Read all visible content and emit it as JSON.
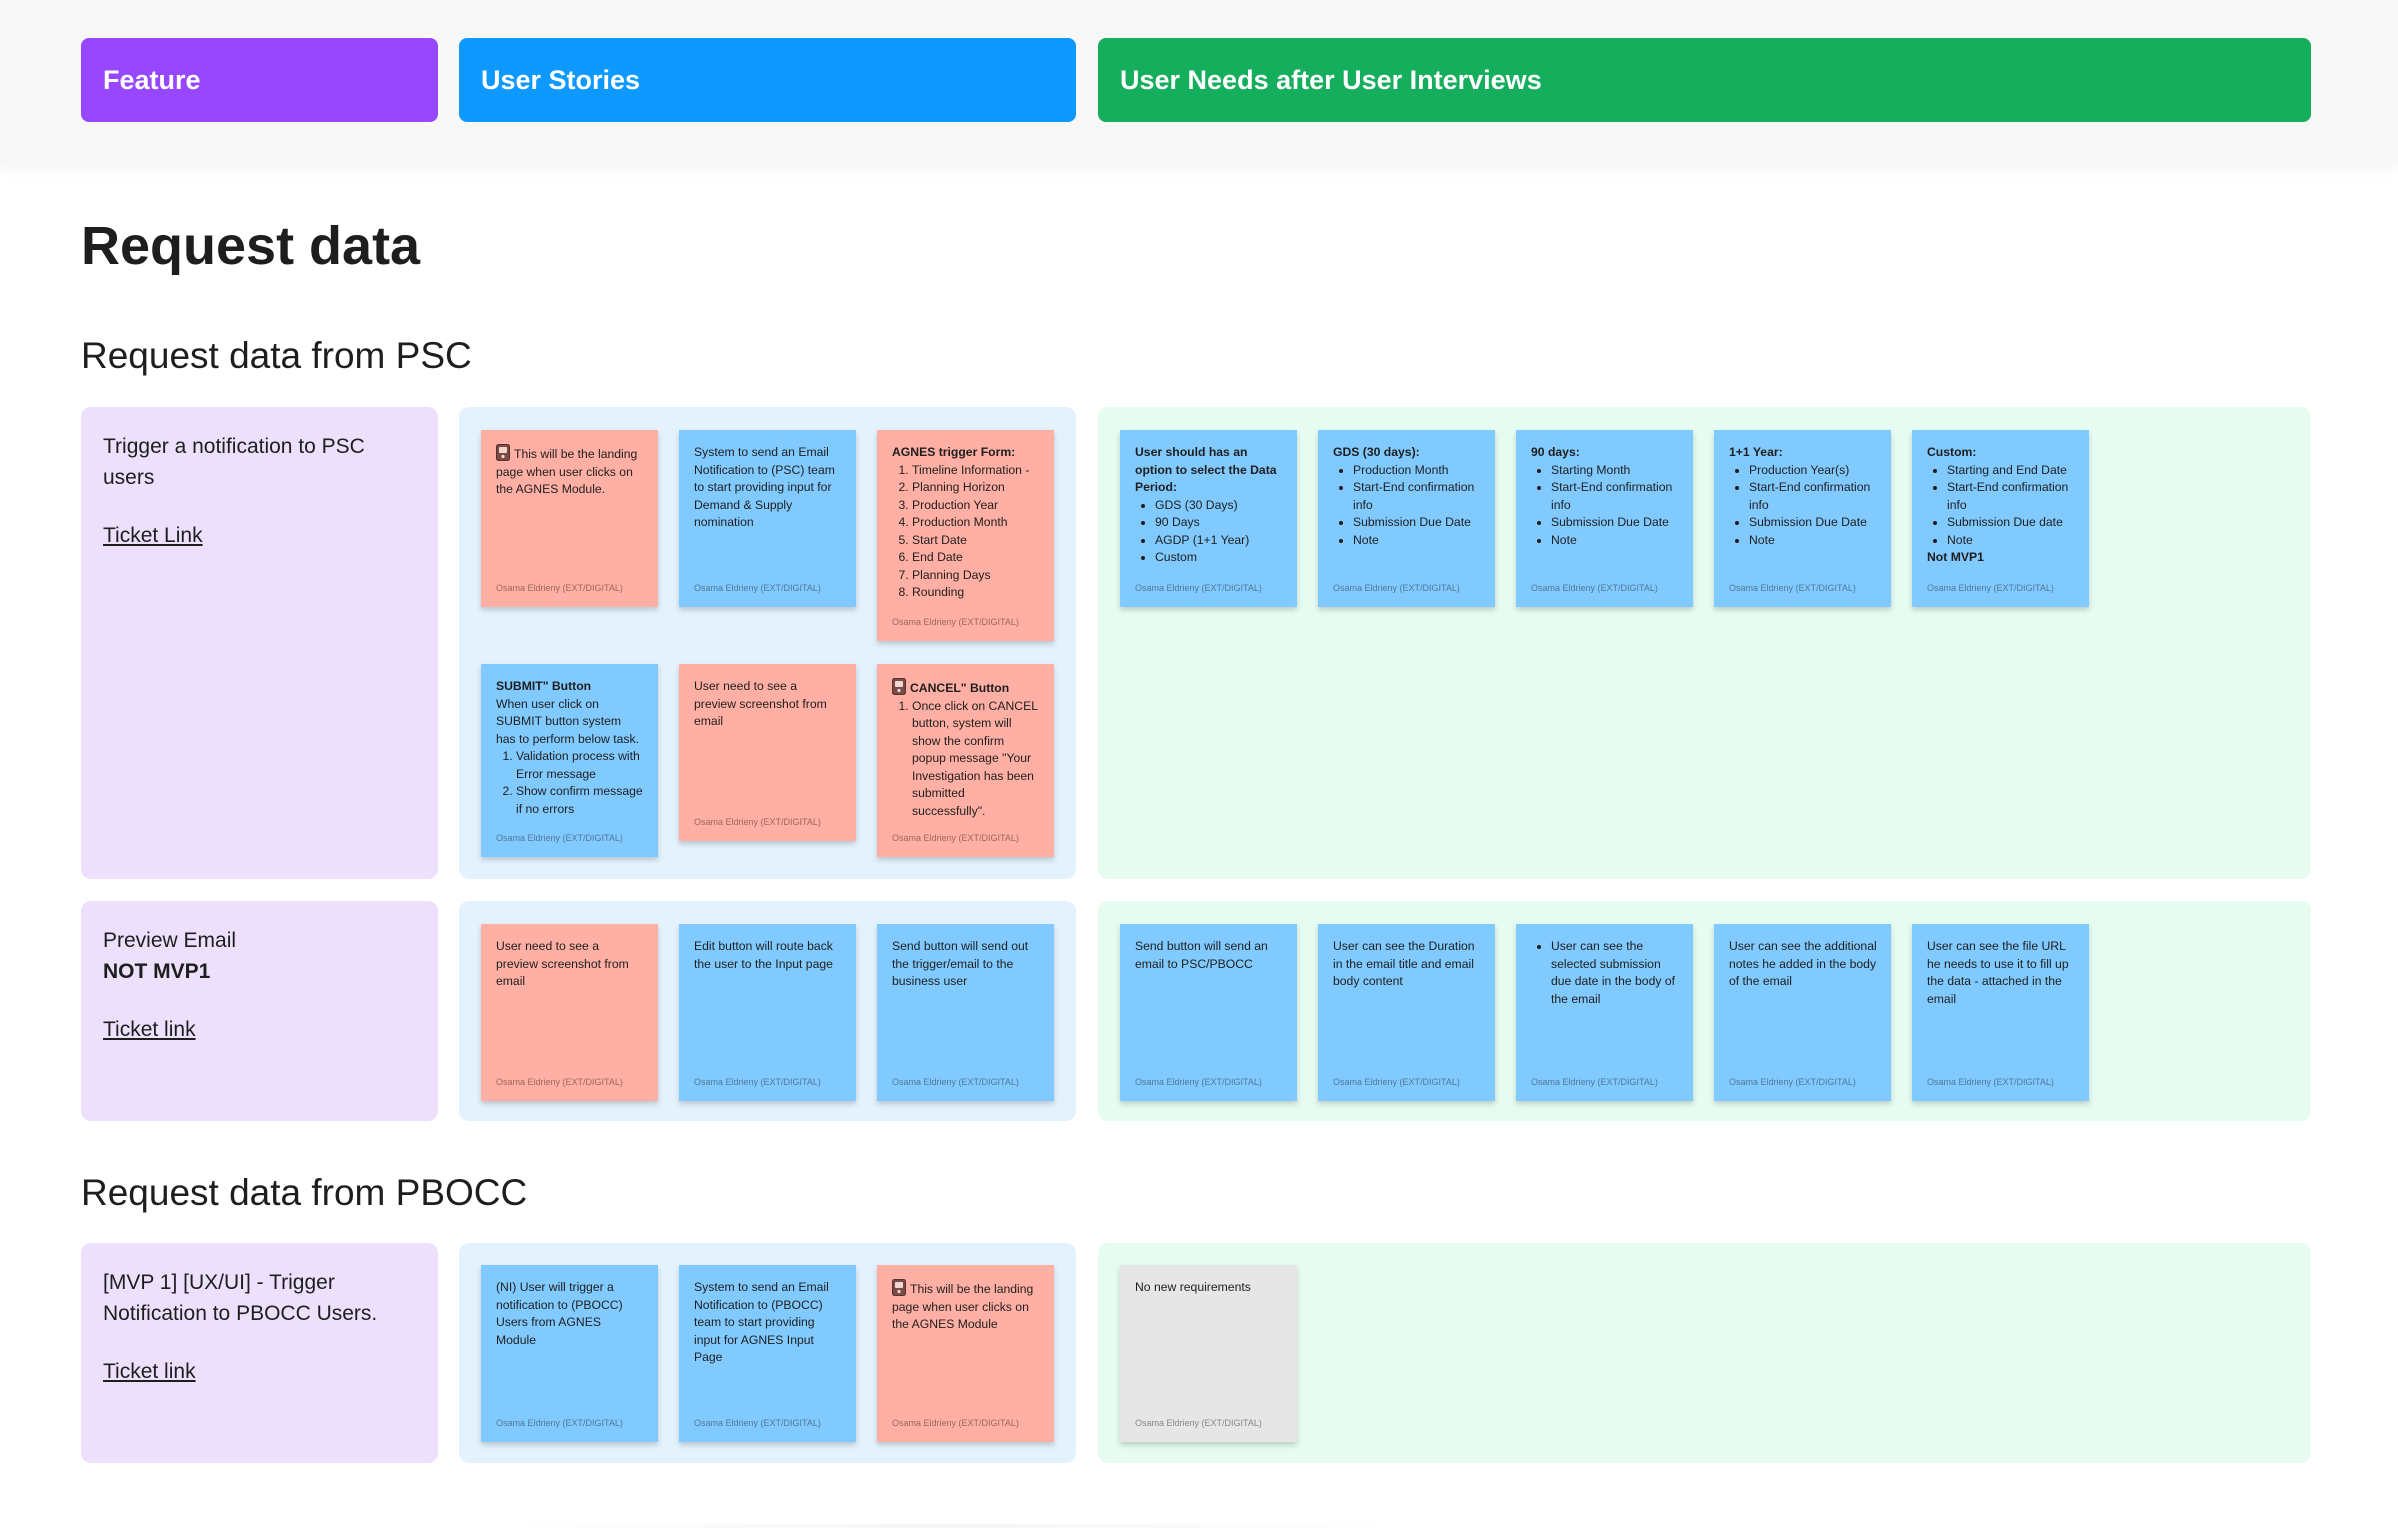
{
  "headers": {
    "feature": "Feature",
    "user_stories": "User Stories",
    "user_needs": "User Needs after User Interviews"
  },
  "page_title": "Request data",
  "sections": [
    {
      "title": "Request data from PSC",
      "rows": [
        {
          "feature_text": "Trigger a notification to PSC users",
          "ticket_link": "Ticket Link",
          "stories": [
            {
              "color": "red",
              "icon": true,
              "text": "This will be the landing page when user clicks on the AGNES Module.",
              "author": "Osama Eldrieny (EXT/DIGITAL)"
            },
            {
              "color": "blue",
              "text": "System to send an Email Notification to (PSC) team to start providing input for Demand & Supply nomination",
              "author": "Osama Eldrieny (EXT/DIGITAL)"
            },
            {
              "color": "red",
              "head": "AGNES trigger Form:",
              "ol": [
                "Timeline Information -",
                "Planning Horizon",
                "Production Year",
                "Production Month",
                "Start Date",
                "End Date",
                "Planning Days",
                "Rounding"
              ],
              "author": "Osama Eldrieny (EXT/DIGITAL)"
            },
            {
              "color": "blue",
              "head": "SUBMIT\" Button",
              "text": "When user click on SUBMIT button system has to perform below task.",
              "ol": [
                "Validation process with Error message",
                "Show confirm message if no errors"
              ],
              "author": "Osama Eldrieny (EXT/DIGITAL)"
            },
            {
              "color": "red",
              "text": "User need to see a preview screenshot from email",
              "author": "Osama Eldrieny (EXT/DIGITAL)"
            },
            {
              "color": "red",
              "icon": true,
              "head": "CANCEL\" Button",
              "ol": [
                "Once click on CANCEL button, system will show the confirm popup message \"Your Investigation has been submitted successfully\"."
              ],
              "author": "Osama Eldrieny (EXT/DIGITAL)"
            }
          ],
          "needs": [
            {
              "color": "blue",
              "head": "User should has an option to select the Data Period:",
              "ul": [
                "GDS (30 Days)",
                "90 Days",
                "AGDP (1+1 Year)",
                "Custom"
              ],
              "author": "Osama Eldrieny (EXT/DIGITAL)"
            },
            {
              "color": "blue",
              "head": "GDS (30 days):",
              "ul": [
                "Production Month",
                "Start-End confirmation info",
                "Submission Due Date",
                "Note"
              ],
              "author": "Osama Eldrieny (EXT/DIGITAL)"
            },
            {
              "color": "blue",
              "head": "90 days:",
              "ul": [
                "Starting Month",
                "Start-End confirmation info",
                "Submission Due Date",
                "Note"
              ],
              "author": "Osama Eldrieny (EXT/DIGITAL)"
            },
            {
              "color": "blue",
              "head": "1+1 Year:",
              "ul": [
                "Production Year(s)",
                "Start-End confirmation info",
                "Submission Due Date",
                "Note"
              ],
              "author": "Osama Eldrieny (EXT/DIGITAL)"
            },
            {
              "color": "blue",
              "head": "Custom:",
              "ul": [
                "Starting and End Date",
                "Start-End confirmation info",
                "Submission Due date",
                "Note"
              ],
              "tail": "Not MVP1",
              "author": "Osama Eldrieny (EXT/DIGITAL)"
            }
          ]
        },
        {
          "feature_text": "Preview Email",
          "feature_bold": "NOT MVP1",
          "ticket_link": "Ticket link",
          "stories": [
            {
              "color": "red",
              "text": "User need to see a preview screenshot from email",
              "author": "Osama Eldrieny (EXT/DIGITAL)"
            },
            {
              "color": "blue",
              "text": "Edit button will route back the user to the Input page",
              "author": "Osama Eldrieny (EXT/DIGITAL)"
            },
            {
              "color": "blue",
              "text": "Send button will send out the trigger/email to the business user",
              "author": "Osama Eldrieny (EXT/DIGITAL)"
            }
          ],
          "needs": [
            {
              "color": "blue",
              "text": "Send button will send an email to PSC/PBOCC",
              "author": "Osama Eldrieny (EXT/DIGITAL)"
            },
            {
              "color": "blue",
              "text": "User can see the Duration in the email title and email body content",
              "author": "Osama Eldrieny (EXT/DIGITAL)"
            },
            {
              "color": "blue",
              "ul": [
                "User can see the selected submission due date in the body of the email"
              ],
              "author": "Osama Eldrieny (EXT/DIGITAL)"
            },
            {
              "color": "blue",
              "text": "User can see the additional notes he added in the body of the email",
              "author": "Osama Eldrieny (EXT/DIGITAL)"
            },
            {
              "color": "blue",
              "text": "User can see the file URL he needs to use it to fill up the data - attached in the email",
              "author": "Osama Eldrieny (EXT/DIGITAL)"
            }
          ]
        }
      ]
    },
    {
      "title": "Request data from PBOCC",
      "rows": [
        {
          "feature_text": "[MVP 1] [UX/UI] - Trigger Notification to PBOCC Users.",
          "ticket_link": "Ticket link",
          "stories": [
            {
              "color": "blue",
              "text": "(NI) User will trigger a notification to (PBOCC) Users from AGNES Module",
              "author": "Osama Eldrieny (EXT/DIGITAL)"
            },
            {
              "color": "blue",
              "text": "System to send an Email Notification to (PBOCC) team to start providing input for AGNES Input Page",
              "author": "Osama Eldrieny (EXT/DIGITAL)"
            },
            {
              "color": "red",
              "icon": true,
              "text": "This will be the landing page when user clicks on the AGNES Module",
              "author": "Osama Eldrieny (EXT/DIGITAL)"
            }
          ],
          "needs": [
            {
              "color": "gray",
              "text": "No new requirements",
              "author": "Osama Eldrieny (EXT/DIGITAL)"
            }
          ]
        }
      ]
    }
  ]
}
